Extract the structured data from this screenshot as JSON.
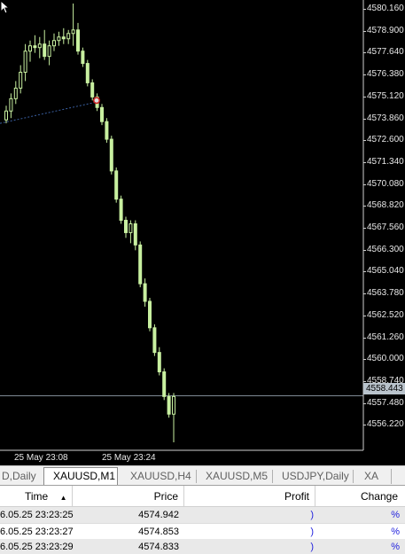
{
  "price_axis": [
    "4580.160",
    "4578.900",
    "4577.640",
    "4576.380",
    "4575.120",
    "4573.860",
    "4572.600",
    "4571.340",
    "4570.080",
    "4568.820",
    "4567.560",
    "4566.300",
    "4565.040",
    "4563.780",
    "4562.520",
    "4561.260",
    "4560.000",
    "4558.740",
    "4557.480",
    "4556.220"
  ],
  "current_price": "4558.443",
  "time_axis": [
    "25 May 23:08",
    "25 May 23:24"
  ],
  "tabs": [
    {
      "label": "D,Daily"
    },
    {
      "label": "XAUUSD,M1"
    },
    {
      "label": "XAUUSD,H4"
    },
    {
      "label": "XAUUSD,M5"
    },
    {
      "label": "USDJPY,Daily"
    },
    {
      "label": "XA"
    }
  ],
  "columns": {
    "time": "Time",
    "price": "Price",
    "profit": "Profit",
    "change": "Change"
  },
  "sort_arrow": "▲",
  "rows": [
    {
      "time": "6.05.25 23:23:25",
      "price": "4574.942",
      "profit": ")",
      "change": "%"
    },
    {
      "time": "6.05.25 23:23:27",
      "price": "4574.853",
      "profit": ")",
      "change": "%"
    },
    {
      "time": "6.05.25 23:23:29",
      "price": "4574.833",
      "profit": ")",
      "change": "%"
    }
  ],
  "chart_data": {
    "type": "candlestick",
    "symbol_timeframe": "XAUUSD,M1",
    "y_range": [
      4555.5,
      4580.9
    ],
    "x_labels": [
      "25 May 23:08",
      "25 May 23:24"
    ],
    "candles": [
      {
        "o": 4574.1,
        "h": 4574.9,
        "l": 4573.9,
        "c": 4574.6
      },
      {
        "o": 4574.6,
        "h": 4575.6,
        "l": 4574.2,
        "c": 4575.3
      },
      {
        "o": 4575.3,
        "h": 4576.3,
        "l": 4575.0,
        "c": 4575.9
      },
      {
        "o": 4575.9,
        "h": 4577.2,
        "l": 4575.6,
        "c": 4576.8
      },
      {
        "o": 4576.8,
        "h": 4578.4,
        "l": 4576.3,
        "c": 4578.0
      },
      {
        "o": 4578.0,
        "h": 4578.6,
        "l": 4577.4,
        "c": 4578.3
      },
      {
        "o": 4578.3,
        "h": 4578.9,
        "l": 4577.9,
        "c": 4578.2
      },
      {
        "o": 4578.2,
        "h": 4578.8,
        "l": 4577.6,
        "c": 4578.4
      },
      {
        "o": 4578.4,
        "h": 4579.2,
        "l": 4577.5,
        "c": 4577.7
      },
      {
        "o": 4577.7,
        "h": 4578.6,
        "l": 4577.2,
        "c": 4578.3
      },
      {
        "o": 4578.3,
        "h": 4579.0,
        "l": 4578.0,
        "c": 4578.6
      },
      {
        "o": 4578.6,
        "h": 4579.1,
        "l": 4578.3,
        "c": 4578.8
      },
      {
        "o": 4578.8,
        "h": 4579.3,
        "l": 4578.4,
        "c": 4578.7
      },
      {
        "o": 4578.7,
        "h": 4579.2,
        "l": 4578.4,
        "c": 4579.0
      },
      {
        "o": 4579.0,
        "h": 4580.7,
        "l": 4578.3,
        "c": 4579.2
      },
      {
        "o": 4579.2,
        "h": 4579.6,
        "l": 4577.8,
        "c": 4578.0
      },
      {
        "o": 4578.0,
        "h": 4578.2,
        "l": 4577.1,
        "c": 4577.3
      },
      {
        "o": 4577.3,
        "h": 4577.5,
        "l": 4576.0,
        "c": 4576.2
      },
      {
        "o": 4576.2,
        "h": 4576.4,
        "l": 4575.2,
        "c": 4575.4
      },
      {
        "o": 4575.4,
        "h": 4575.6,
        "l": 4574.6,
        "c": 4574.8
      },
      {
        "o": 4574.8,
        "h": 4575.0,
        "l": 4573.8,
        "c": 4574.0
      },
      {
        "o": 4574.0,
        "h": 4574.2,
        "l": 4572.8,
        "c": 4573.0
      },
      {
        "o": 4573.0,
        "h": 4573.2,
        "l": 4571.0,
        "c": 4571.2
      },
      {
        "o": 4571.2,
        "h": 4571.4,
        "l": 4569.4,
        "c": 4569.6
      },
      {
        "o": 4569.6,
        "h": 4569.8,
        "l": 4568.2,
        "c": 4568.4
      },
      {
        "o": 4568.4,
        "h": 4568.6,
        "l": 4567.4,
        "c": 4567.7
      },
      {
        "o": 4567.7,
        "h": 4568.4,
        "l": 4567.1,
        "c": 4568.2
      },
      {
        "o": 4568.2,
        "h": 4568.4,
        "l": 4566.7,
        "c": 4567.0
      },
      {
        "o": 4567.0,
        "h": 4567.2,
        "l": 4564.6,
        "c": 4564.8
      },
      {
        "o": 4564.8,
        "h": 4565.1,
        "l": 4563.5,
        "c": 4563.8
      },
      {
        "o": 4563.8,
        "h": 4564.0,
        "l": 4562.1,
        "c": 4562.3
      },
      {
        "o": 4562.3,
        "h": 4562.5,
        "l": 4560.7,
        "c": 4560.9
      },
      {
        "o": 4560.9,
        "h": 4561.2,
        "l": 4559.6,
        "c": 4559.8
      },
      {
        "o": 4559.8,
        "h": 4560.0,
        "l": 4558.2,
        "c": 4558.4
      },
      {
        "o": 4558.4,
        "h": 4558.6,
        "l": 4557.2,
        "c": 4557.4
      },
      {
        "o": 4557.4,
        "h": 4558.6,
        "l": 4555.8,
        "c": 4558.4
      }
    ],
    "trendline": {
      "from": 4573.9,
      "to": 4575.1
    },
    "bid_line": 4558.443
  },
  "colors": {
    "bull": "#c8f0a0",
    "bear": "#c8f0a0",
    "grid": "#1a1a1a",
    "bid": "#7f8a94",
    "trend": "#3a5fa0",
    "up": "#ffffff"
  }
}
